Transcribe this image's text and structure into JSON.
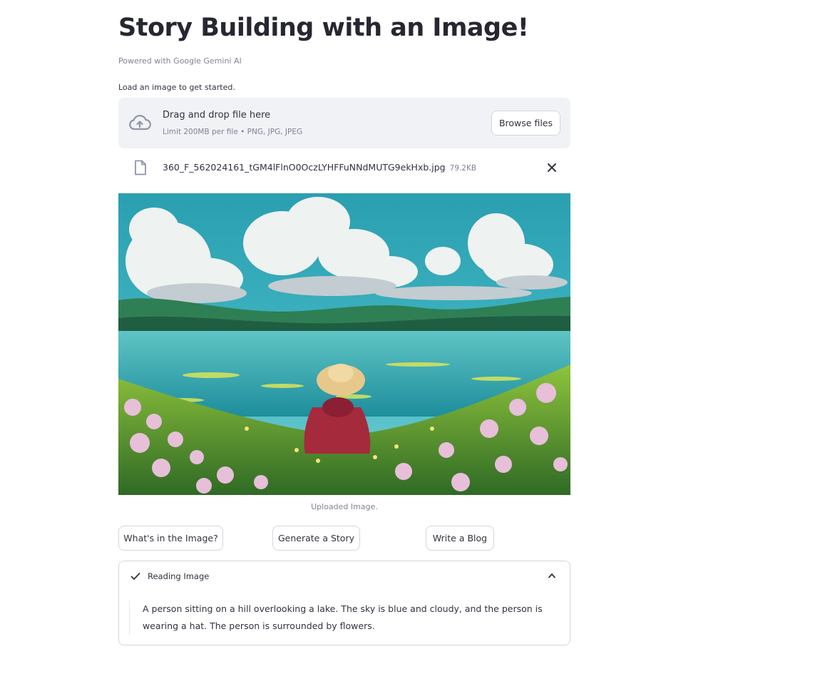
{
  "page": {
    "title": "Story Building with an Image!",
    "subtitle": "Powered with Google Gemini AI"
  },
  "uploader": {
    "label": "Load an image to get started.",
    "dropzone_title": "Drag and drop file here",
    "dropzone_limit": "Limit 200MB per file • PNG, JPG, JPEG",
    "browse_label": "Browse files",
    "icon": "cloud-upload-icon"
  },
  "uploaded_file": {
    "name": "360_F_562024161_tGM4lFlnO0OczLYHFFuNNdMUTG9ekHxb.jpg",
    "size": "79.2KB",
    "icon": "file-icon"
  },
  "image": {
    "caption": "Uploaded Image."
  },
  "actions": {
    "whats_in_image": "What's in the Image?",
    "generate_story": "Generate a Story",
    "write_blog": "Write a Blog"
  },
  "expander": {
    "title": "Reading Image",
    "status_icon": "check-icon",
    "toggle_icon": "chevron-up-icon",
    "body": "A person sitting on a hill overlooking a lake. The sky is blue and cloudy, and the person is wearing a hat. The person is surrounded by flowers."
  },
  "colors": {
    "dropzone_bg": "#f0f2f6",
    "text": "#31333f",
    "muted": "#808495",
    "border": "#d6d6d9"
  }
}
